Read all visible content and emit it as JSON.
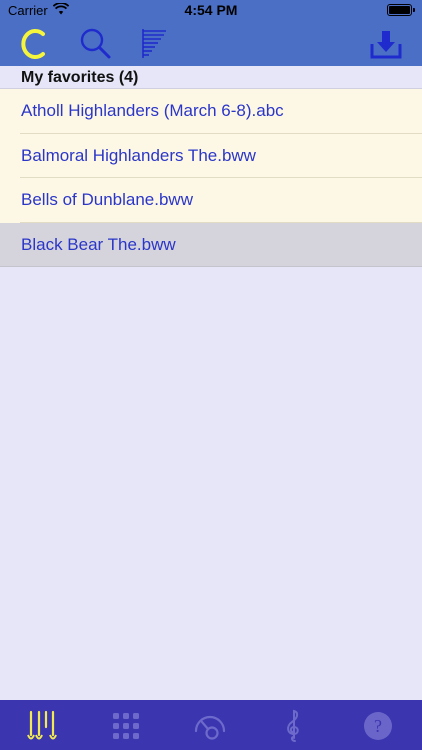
{
  "status_bar": {
    "carrier": "Carrier",
    "time": "4:54 PM",
    "wifi_icon": "wifi-icon",
    "battery_icon": "battery-icon"
  },
  "toolbar": {
    "tools": [
      {
        "icon": "c-logo-icon",
        "color": "#f5f53c"
      },
      {
        "icon": "search-icon",
        "color": "#1f2bcc"
      },
      {
        "icon": "sort-list-icon",
        "color": "#1f2bcc"
      },
      {
        "icon": "download-icon",
        "color": "#1f2bcc"
      }
    ],
    "background": "#4a6fc4"
  },
  "section": {
    "title": "My favorites (4)"
  },
  "files": [
    {
      "name": "Atholl Highlanders (March 6-8).abc",
      "selected": false
    },
    {
      "name": "Balmoral Highlanders The.bww",
      "selected": false
    },
    {
      "name": "Bells of Dunblane.bww",
      "selected": false
    },
    {
      "name": "Black Bear The.bww",
      "selected": true
    }
  ],
  "tab_bar": {
    "background": "#3b35b0",
    "tabs": [
      {
        "icon": "pipes-icon",
        "active": true
      },
      {
        "icon": "grid-icon",
        "active": false
      },
      {
        "icon": "tuner-icon",
        "active": false
      },
      {
        "icon": "treble-clef-icon",
        "active": false
      },
      {
        "icon": "help-icon",
        "active": false
      }
    ]
  },
  "colors": {
    "row_background": "#fdf8e6",
    "selected_row": "#d5d4dc",
    "link_text": "#2b36c8",
    "page_background": "#e6e6f8"
  }
}
